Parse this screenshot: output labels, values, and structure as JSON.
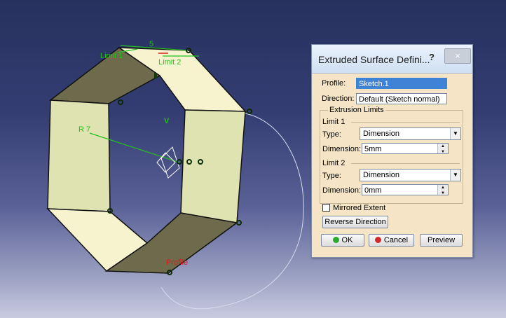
{
  "colors": {
    "accent": "#3f83d6",
    "annotation_green": "#22c11e",
    "annotation_red": "#d41e1e"
  },
  "scene": {
    "dim_value": "5",
    "limit1": "Limit 1",
    "limit2": "Limit 2",
    "radius": "R 7",
    "v_marker": "V",
    "profile": "Profile"
  },
  "dialog": {
    "title": "Extruded Surface Defini...",
    "help": "?",
    "close": "×",
    "profile_label": "Profile:",
    "profile_value": "Sketch.1",
    "direction_label": "Direction:",
    "direction_value": "Default (Sketch normal)",
    "limits_group": "Extrusion Limits",
    "limit1": {
      "title": "Limit 1",
      "type_label": "Type:",
      "type_value": "Dimension",
      "dimension_label": "Dimension:",
      "dimension_value": "5mm"
    },
    "limit2": {
      "title": "Limit 2",
      "type_label": "Type:",
      "type_value": "Dimension",
      "dimension_label": "Dimension:",
      "dimension_value": "0mm"
    },
    "mirrored_label": "Mirrored Extent",
    "reverse_button": "Reverse Direction",
    "ok": "OK",
    "cancel": "Cancel",
    "preview": "Preview"
  }
}
